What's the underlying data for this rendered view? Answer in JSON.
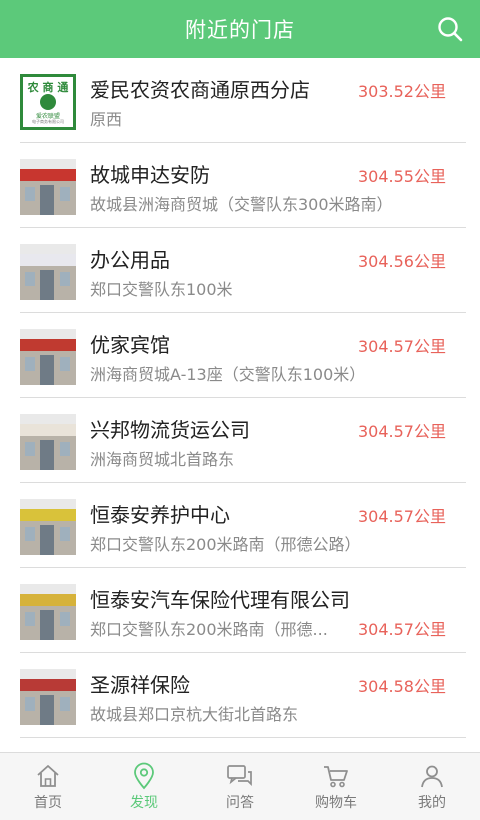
{
  "header": {
    "title": "附近的门店",
    "search_icon": "search-icon"
  },
  "colors": {
    "accent": "#5cc97a",
    "distance": "#e8625a",
    "muted": "#8a8a8a"
  },
  "stores": [
    {
      "name": "爱民农资农商通原西分店",
      "address": "原西",
      "distance": "303.52公里",
      "thumb": {
        "type": "logo",
        "line1": "农 商 通",
        "line2": "爱农联盟",
        "line3": "电子商务有限公司"
      }
    },
    {
      "name": "故城申达安防",
      "address": "故城县洲海商贸城（交警队东300米路南）",
      "distance": "304.55公里",
      "thumb": {
        "type": "shop",
        "sign_color": "#c8362f"
      }
    },
    {
      "name": "办公用品",
      "address": "郑口交警队东100米",
      "distance": "304.56公里",
      "thumb": {
        "type": "shop",
        "sign_color": "#e8e8ee"
      }
    },
    {
      "name": "优家宾馆",
      "address": "洲海商贸城A-13座（交警队东100米）",
      "distance": "304.57公里",
      "thumb": {
        "type": "shop",
        "sign_color": "#c03a30"
      }
    },
    {
      "name": "兴邦物流货运公司",
      "address": "洲海商贸城北首路东",
      "distance": "304.57公里",
      "thumb": {
        "type": "shop",
        "sign_color": "#e9e3d9"
      }
    },
    {
      "name": "恒泰安养护中心",
      "address": "郑口交警队东200米路南（邢德公路）",
      "distance": "304.57公里",
      "thumb": {
        "type": "shop",
        "sign_color": "#d9c23a"
      }
    },
    {
      "name": "恒泰安汽车保险代理有限公司",
      "address": "郑口交警队东200米路南（邢德...",
      "distance": "304.57公里",
      "thumb": {
        "type": "shop",
        "sign_color": "#d6b23a"
      }
    },
    {
      "name": "圣源祥保险",
      "address": "故城县郑口京杭大街北首路东",
      "distance": "304.58公里",
      "thumb": {
        "type": "shop",
        "sign_color": "#b83a36"
      }
    }
  ],
  "tabs": [
    {
      "label": "首页",
      "icon": "home-icon",
      "active": false
    },
    {
      "label": "发现",
      "icon": "location-pin-icon",
      "active": true
    },
    {
      "label": "问答",
      "icon": "chat-bubbles-icon",
      "active": false
    },
    {
      "label": "购物车",
      "icon": "shopping-cart-icon",
      "active": false
    },
    {
      "label": "我的",
      "icon": "person-icon",
      "active": false
    }
  ]
}
